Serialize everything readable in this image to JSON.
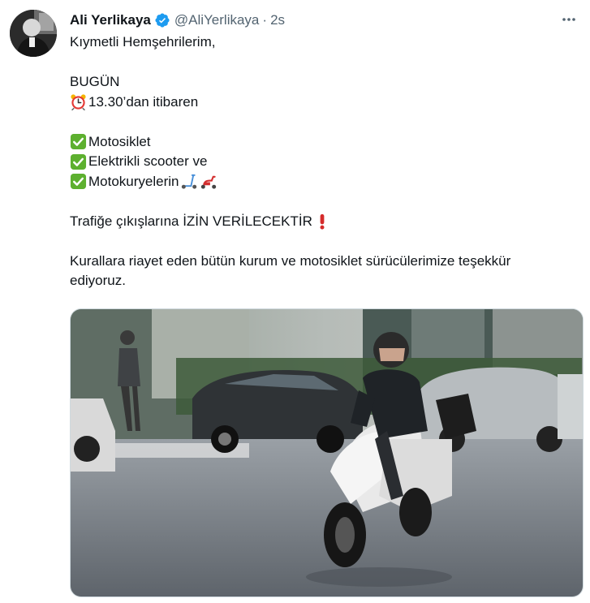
{
  "tweet": {
    "author_name": "Ali Yerlikaya",
    "handle": "@AliYerlikaya",
    "separator": "·",
    "time": "2s",
    "lines": {
      "greeting": "Kıymetli Hemşehrilerim,",
      "today": "BUGÜN",
      "time_text": "13.30’dan itibaren",
      "item1": "Motosiklet",
      "item2": "Elektrikli scooter ve",
      "item3": "Motokuryelerin",
      "traffic_prefix": "Trafiğe çıkışlarına ",
      "traffic_emphasis": "İZİN VERİLECEKTİR",
      "thanks": "Kurallara riayet eden bütün kurum ve motosiklet sürücülerimize teşekkür",
      "thanks_cont": "ediyoruz."
    },
    "icons": {
      "verified": "verified-badge-icon",
      "more": "more-options-icon",
      "alarm": "alarm-clock-icon",
      "check": "check-mark-button-icon",
      "scooter": "kick-scooter-icon",
      "motor_scooter": "motor-scooter-icon",
      "exclamation": "red-exclamation-icon"
    },
    "colors": {
      "verified": "#1d9bf0",
      "check_green": "#5db02f",
      "exclamation_red": "#d52b2b",
      "secondary_text": "#536471"
    }
  }
}
